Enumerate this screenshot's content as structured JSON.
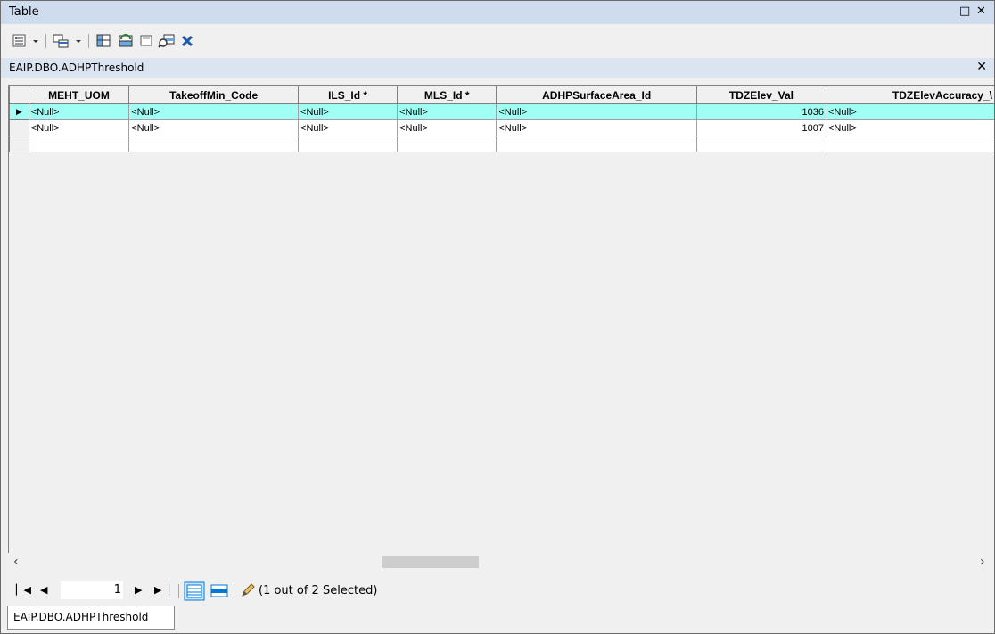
{
  "window": {
    "title": "Table"
  },
  "toolbar": {
    "icons": [
      "table-options-icon",
      "related-tables-icon",
      "select-by-attributes-icon",
      "switch-selection-icon",
      "clear-selection-icon",
      "zoom-to-selected-icon",
      "delete-selected-icon"
    ]
  },
  "table_tab": {
    "name": "EAIP.DBO.ADHPThreshold"
  },
  "grid": {
    "columns": [
      "MEHT_UOM",
      "TakeoffMin_Code",
      "ILS_Id *",
      "MLS_Id *",
      "ADHPSurfaceArea_Id",
      "TDZElev_Val",
      "TDZElevAccuracy_\\"
    ],
    "rows": [
      {
        "selected": true,
        "current": true,
        "cells": [
          "<Null>",
          "<Null>",
          "<Null>",
          "<Null>",
          "<Null>",
          "1036",
          "<Null>"
        ]
      },
      {
        "selected": false,
        "current": false,
        "cells": [
          "<Null>",
          "<Null>",
          "<Null>",
          "<Null>",
          "<Null>",
          "1007",
          "<Null>"
        ]
      },
      {
        "selected": false,
        "current": false,
        "cells": [
          "",
          "",
          "",
          "",
          "",
          "",
          ""
        ]
      }
    ]
  },
  "navigation": {
    "current_record": "1",
    "selection_status": "(1 out of 2 Selected)"
  },
  "sheet_tab": {
    "label": "EAIP.DBO.ADHPThreshold"
  },
  "colors": {
    "selected_row": "#9ffff4",
    "title_bar": "#cfdcee",
    "tab_header": "#dbe5f1",
    "view_button_blue": "#0078d7"
  }
}
